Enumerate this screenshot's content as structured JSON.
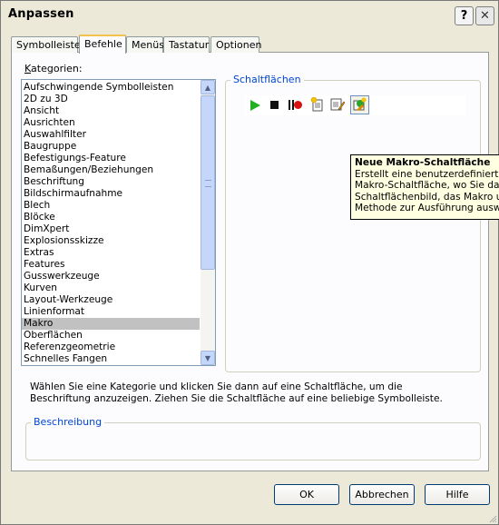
{
  "window": {
    "title": "Anpassen",
    "help_glyph": "?",
    "close_glyph": "✕"
  },
  "tabs": [
    {
      "label": "Symbolleisten",
      "active": false
    },
    {
      "label": "Befehle",
      "active": true
    },
    {
      "label": "Menüs",
      "active": false
    },
    {
      "label": "Tastatur",
      "active": false
    },
    {
      "label": "Optionen",
      "active": false
    }
  ],
  "categories": {
    "label_prefix": "K",
    "label_rest": "ategorien:",
    "items": [
      "Aufschwingende Symbolleisten",
      "2D zu 3D",
      "Ansicht",
      "Ausrichten",
      "Auswahlfilter",
      "Baugruppe",
      "Befestigungs-Feature",
      "Bemaßungen/Beziehungen",
      "Beschriftung",
      "Bildschirmaufnahme",
      "Blech",
      "Blöcke",
      "DimXpert",
      "Explosionsskizze",
      "Extras",
      "Features",
      "Gusswerkzeuge",
      "Kurven",
      "Layout-Werkzeuge",
      "Linienformat",
      "Makro",
      "Oberflächen",
      "Referenzgeometrie",
      "Schnelles Fangen"
    ],
    "selected": "Makro"
  },
  "buttons_group": {
    "title": "Schaltflächen",
    "icons": [
      "run-macro-icon",
      "stop-macro-icon",
      "pause-record-macro-icon",
      "new-macro-icon",
      "edit-macro-icon",
      "new-macro-button-icon"
    ]
  },
  "tooltip": {
    "title": "Neue Makro-Schaltfläche",
    "lines": [
      "Erstellt eine benutzerdefinierte",
      "Makro-Schaltfläche, wo Sie das",
      "Schaltflächenbild, das Makro und",
      "Methode zur Ausführung auswäh"
    ]
  },
  "hint": {
    "text": "Wählen Sie eine Kategorie und klicken Sie dann auf eine Schaltfläche, um die Beschriftung anzuzeigen. Ziehen Sie die Schaltfläche auf eine beliebige Symbolleiste."
  },
  "description": {
    "title": "Beschreibung",
    "text": ""
  },
  "footer": {
    "ok": "OK",
    "cancel": "Abbrechen",
    "help": "Hilfe"
  },
  "colors": {
    "dialog_bg": "#ECE9D8",
    "group_title": "#0046D5",
    "tooltip_bg": "#FFFFE1",
    "selection": "#C1C1C1",
    "play_green": "#22B022",
    "record_red": "#D81010"
  }
}
